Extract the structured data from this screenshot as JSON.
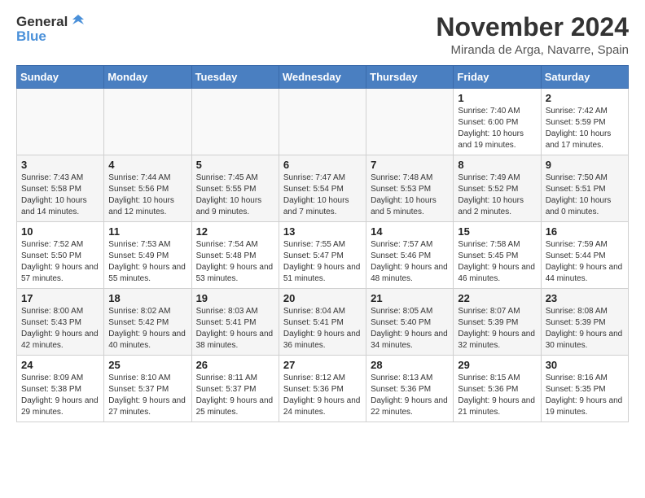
{
  "header": {
    "logo_general": "General",
    "logo_blue": "Blue",
    "month_title": "November 2024",
    "location": "Miranda de Arga, Navarre, Spain"
  },
  "weekdays": [
    "Sunday",
    "Monday",
    "Tuesday",
    "Wednesday",
    "Thursday",
    "Friday",
    "Saturday"
  ],
  "weeks": [
    {
      "row_class": "row-week1",
      "days": [
        {
          "number": "",
          "info": ""
        },
        {
          "number": "",
          "info": ""
        },
        {
          "number": "",
          "info": ""
        },
        {
          "number": "",
          "info": ""
        },
        {
          "number": "",
          "info": ""
        },
        {
          "number": "1",
          "info": "Sunrise: 7:40 AM\nSunset: 6:00 PM\nDaylight: 10 hours and 19 minutes."
        },
        {
          "number": "2",
          "info": "Sunrise: 7:42 AM\nSunset: 5:59 PM\nDaylight: 10 hours and 17 minutes."
        }
      ]
    },
    {
      "row_class": "row-week2",
      "days": [
        {
          "number": "3",
          "info": "Sunrise: 7:43 AM\nSunset: 5:58 PM\nDaylight: 10 hours and 14 minutes."
        },
        {
          "number": "4",
          "info": "Sunrise: 7:44 AM\nSunset: 5:56 PM\nDaylight: 10 hours and 12 minutes."
        },
        {
          "number": "5",
          "info": "Sunrise: 7:45 AM\nSunset: 5:55 PM\nDaylight: 10 hours and 9 minutes."
        },
        {
          "number": "6",
          "info": "Sunrise: 7:47 AM\nSunset: 5:54 PM\nDaylight: 10 hours and 7 minutes."
        },
        {
          "number": "7",
          "info": "Sunrise: 7:48 AM\nSunset: 5:53 PM\nDaylight: 10 hours and 5 minutes."
        },
        {
          "number": "8",
          "info": "Sunrise: 7:49 AM\nSunset: 5:52 PM\nDaylight: 10 hours and 2 minutes."
        },
        {
          "number": "9",
          "info": "Sunrise: 7:50 AM\nSunset: 5:51 PM\nDaylight: 10 hours and 0 minutes."
        }
      ]
    },
    {
      "row_class": "row-week3",
      "days": [
        {
          "number": "10",
          "info": "Sunrise: 7:52 AM\nSunset: 5:50 PM\nDaylight: 9 hours and 57 minutes."
        },
        {
          "number": "11",
          "info": "Sunrise: 7:53 AM\nSunset: 5:49 PM\nDaylight: 9 hours and 55 minutes."
        },
        {
          "number": "12",
          "info": "Sunrise: 7:54 AM\nSunset: 5:48 PM\nDaylight: 9 hours and 53 minutes."
        },
        {
          "number": "13",
          "info": "Sunrise: 7:55 AM\nSunset: 5:47 PM\nDaylight: 9 hours and 51 minutes."
        },
        {
          "number": "14",
          "info": "Sunrise: 7:57 AM\nSunset: 5:46 PM\nDaylight: 9 hours and 48 minutes."
        },
        {
          "number": "15",
          "info": "Sunrise: 7:58 AM\nSunset: 5:45 PM\nDaylight: 9 hours and 46 minutes."
        },
        {
          "number": "16",
          "info": "Sunrise: 7:59 AM\nSunset: 5:44 PM\nDaylight: 9 hours and 44 minutes."
        }
      ]
    },
    {
      "row_class": "row-week4",
      "days": [
        {
          "number": "17",
          "info": "Sunrise: 8:00 AM\nSunset: 5:43 PM\nDaylight: 9 hours and 42 minutes."
        },
        {
          "number": "18",
          "info": "Sunrise: 8:02 AM\nSunset: 5:42 PM\nDaylight: 9 hours and 40 minutes."
        },
        {
          "number": "19",
          "info": "Sunrise: 8:03 AM\nSunset: 5:41 PM\nDaylight: 9 hours and 38 minutes."
        },
        {
          "number": "20",
          "info": "Sunrise: 8:04 AM\nSunset: 5:41 PM\nDaylight: 9 hours and 36 minutes."
        },
        {
          "number": "21",
          "info": "Sunrise: 8:05 AM\nSunset: 5:40 PM\nDaylight: 9 hours and 34 minutes."
        },
        {
          "number": "22",
          "info": "Sunrise: 8:07 AM\nSunset: 5:39 PM\nDaylight: 9 hours and 32 minutes."
        },
        {
          "number": "23",
          "info": "Sunrise: 8:08 AM\nSunset: 5:39 PM\nDaylight: 9 hours and 30 minutes."
        }
      ]
    },
    {
      "row_class": "row-week5",
      "days": [
        {
          "number": "24",
          "info": "Sunrise: 8:09 AM\nSunset: 5:38 PM\nDaylight: 9 hours and 29 minutes."
        },
        {
          "number": "25",
          "info": "Sunrise: 8:10 AM\nSunset: 5:37 PM\nDaylight: 9 hours and 27 minutes."
        },
        {
          "number": "26",
          "info": "Sunrise: 8:11 AM\nSunset: 5:37 PM\nDaylight: 9 hours and 25 minutes."
        },
        {
          "number": "27",
          "info": "Sunrise: 8:12 AM\nSunset: 5:36 PM\nDaylight: 9 hours and 24 minutes."
        },
        {
          "number": "28",
          "info": "Sunrise: 8:13 AM\nSunset: 5:36 PM\nDaylight: 9 hours and 22 minutes."
        },
        {
          "number": "29",
          "info": "Sunrise: 8:15 AM\nSunset: 5:36 PM\nDaylight: 9 hours and 21 minutes."
        },
        {
          "number": "30",
          "info": "Sunrise: 8:16 AM\nSunset: 5:35 PM\nDaylight: 9 hours and 19 minutes."
        }
      ]
    }
  ]
}
